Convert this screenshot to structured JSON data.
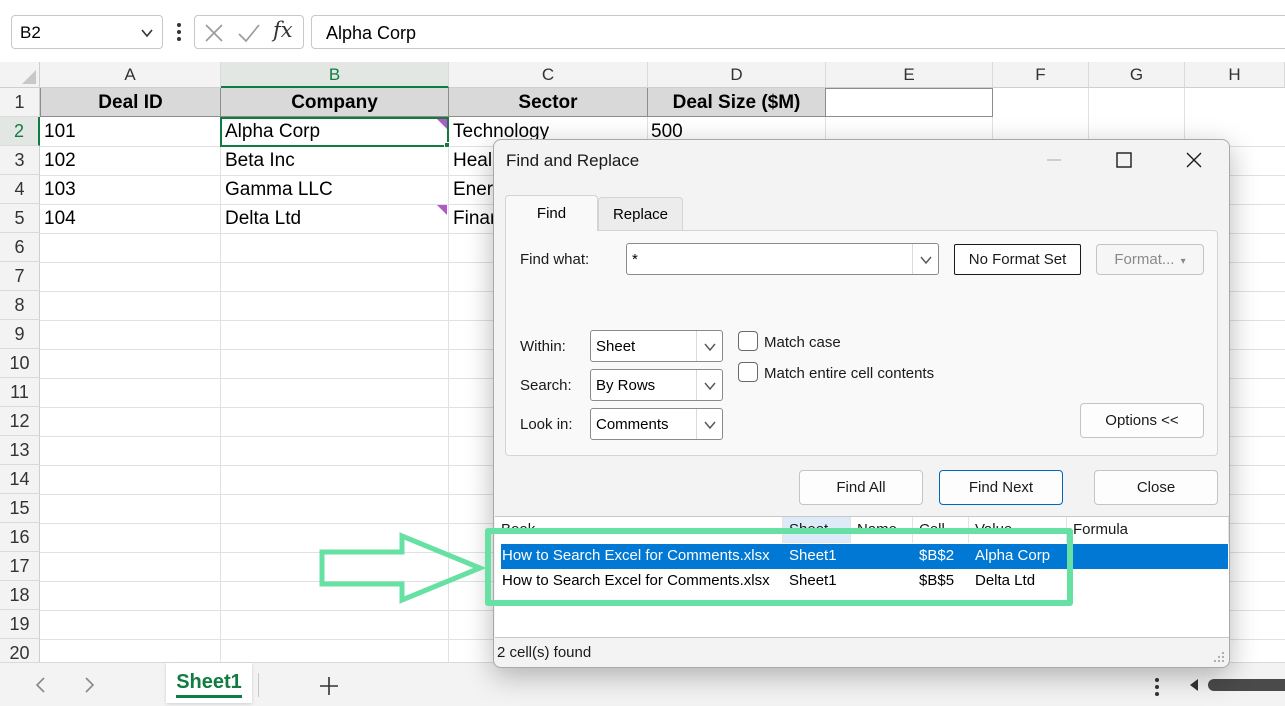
{
  "formula_bar": {
    "name_box": "B2",
    "formula": "Alpha Corp",
    "fx_label": "fx"
  },
  "columns": [
    "A",
    "B",
    "C",
    "D",
    "E",
    "F",
    "G",
    "H"
  ],
  "rows": [
    "1",
    "2",
    "3",
    "4",
    "5",
    "6",
    "7",
    "8",
    "9",
    "10",
    "11",
    "12",
    "13",
    "14",
    "15",
    "16",
    "17",
    "18",
    "19",
    "20"
  ],
  "table": {
    "headers": [
      "Deal ID",
      "Company",
      "Sector",
      "Deal Size ($M)"
    ],
    "rows": [
      [
        "101",
        "Alpha Corp",
        "Technology",
        "500"
      ],
      [
        "102",
        "Beta Inc",
        "Heal",
        ""
      ],
      [
        "103",
        "Gamma LLC",
        "Ener",
        ""
      ],
      [
        "104",
        "Delta Ltd",
        "Finar",
        ""
      ]
    ]
  },
  "sheet_tabs": {
    "active": "Sheet1"
  },
  "dialog": {
    "title": "Find and Replace",
    "tabs": [
      "Find",
      "Replace"
    ],
    "find_what_label": "Find what:",
    "find_what_value": "*",
    "no_format_label": "No Format Set",
    "format_button": "Format...",
    "within_label": "Within:",
    "within_value": "Sheet",
    "search_label": "Search:",
    "search_value": "By Rows",
    "look_in_label": "Look in:",
    "look_in_value": "Comments",
    "match_case_label": "Match case",
    "match_entire_label": "Match entire cell contents",
    "options_button": "Options <<",
    "find_all_button": "Find All",
    "find_next_button": "Find Next",
    "close_button": "Close",
    "results_columns": [
      "Book",
      "Sheet",
      "Name",
      "Cell",
      "Value",
      "Formula"
    ],
    "results": [
      {
        "book": "How to Search Excel for Comments.xlsx",
        "sheet": "Sheet1",
        "name": "",
        "cell": "$B$2",
        "value": "Alpha Corp",
        "formula": ""
      },
      {
        "book": "How to Search Excel for Comments.xlsx",
        "sheet": "Sheet1",
        "name": "",
        "cell": "$B$5",
        "value": "Delta Ltd",
        "formula": ""
      }
    ],
    "status": "2 cell(s) found"
  },
  "colors": {
    "excel_green": "#107c41",
    "selection_blue": "#0078d4",
    "highlight_green": "#66e0a3",
    "comment_indicator": "#b05ac8"
  }
}
